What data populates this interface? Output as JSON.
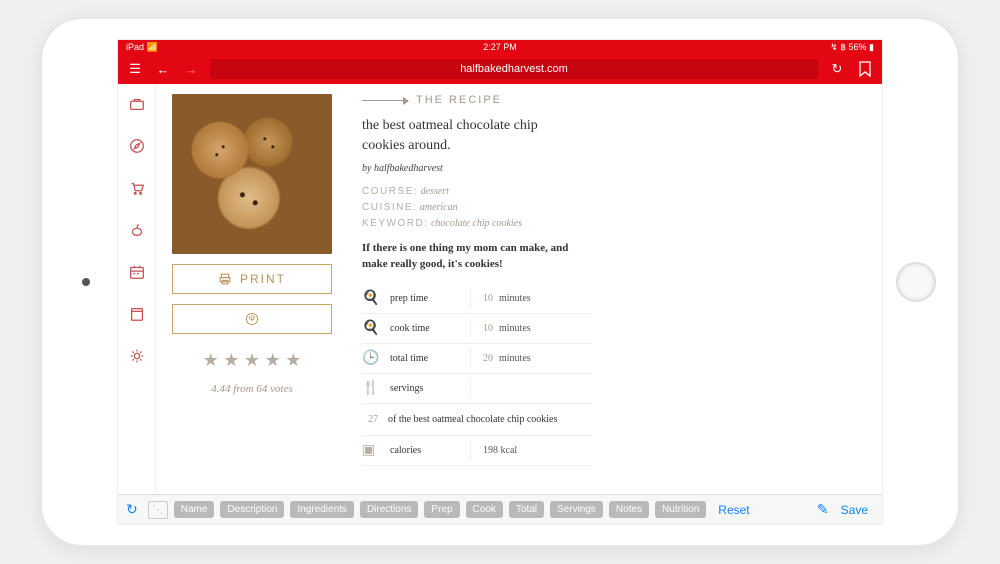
{
  "status_bar": {
    "carrier": "iPad",
    "time": "2:27 PM",
    "battery": "56%"
  },
  "toolbar": {
    "url": "halfbakedharvest.com"
  },
  "sidebar": {
    "items": [
      "briefcase",
      "compass",
      "cart",
      "fruit",
      "calendar",
      "book",
      "gear"
    ]
  },
  "print_button": "PRINT",
  "rating": {
    "value": "4.44",
    "from": "from",
    "votes": "64",
    "votes_word": "votes"
  },
  "recipe": {
    "section_label": "THE RECIPE",
    "title": "the best oatmeal chocolate chip cookies around.",
    "byline": "by halfbakedharvest",
    "meta": {
      "course_label": "COURSE:",
      "course": "dessert",
      "cuisine_label": "CUISINE:",
      "cuisine": "american",
      "keyword_label": "KEYWORD:",
      "keyword": "chocolate chip cookies"
    },
    "description": "If there is one thing my mom can make, and make really good, it's cookies!",
    "times": {
      "prep": {
        "label": "prep time",
        "value": "10",
        "unit": "minutes"
      },
      "cook": {
        "label": "cook time",
        "value": "10",
        "unit": "minutes"
      },
      "total": {
        "label": "total time",
        "value": "20",
        "unit": "minutes"
      },
      "servings": {
        "label": "servings"
      }
    },
    "yield": {
      "num": "27",
      "text": "of the best oatmeal chocolate chip cookies"
    },
    "calories": {
      "label": "calories",
      "value": "198 kcal"
    }
  },
  "bottom": {
    "chips": [
      "Name",
      "Description",
      "Ingredients",
      "Directions",
      "Prep",
      "Cook",
      "Total",
      "Servings",
      "Notes",
      "Nutrition"
    ],
    "reset": "Reset",
    "save": "Save"
  }
}
